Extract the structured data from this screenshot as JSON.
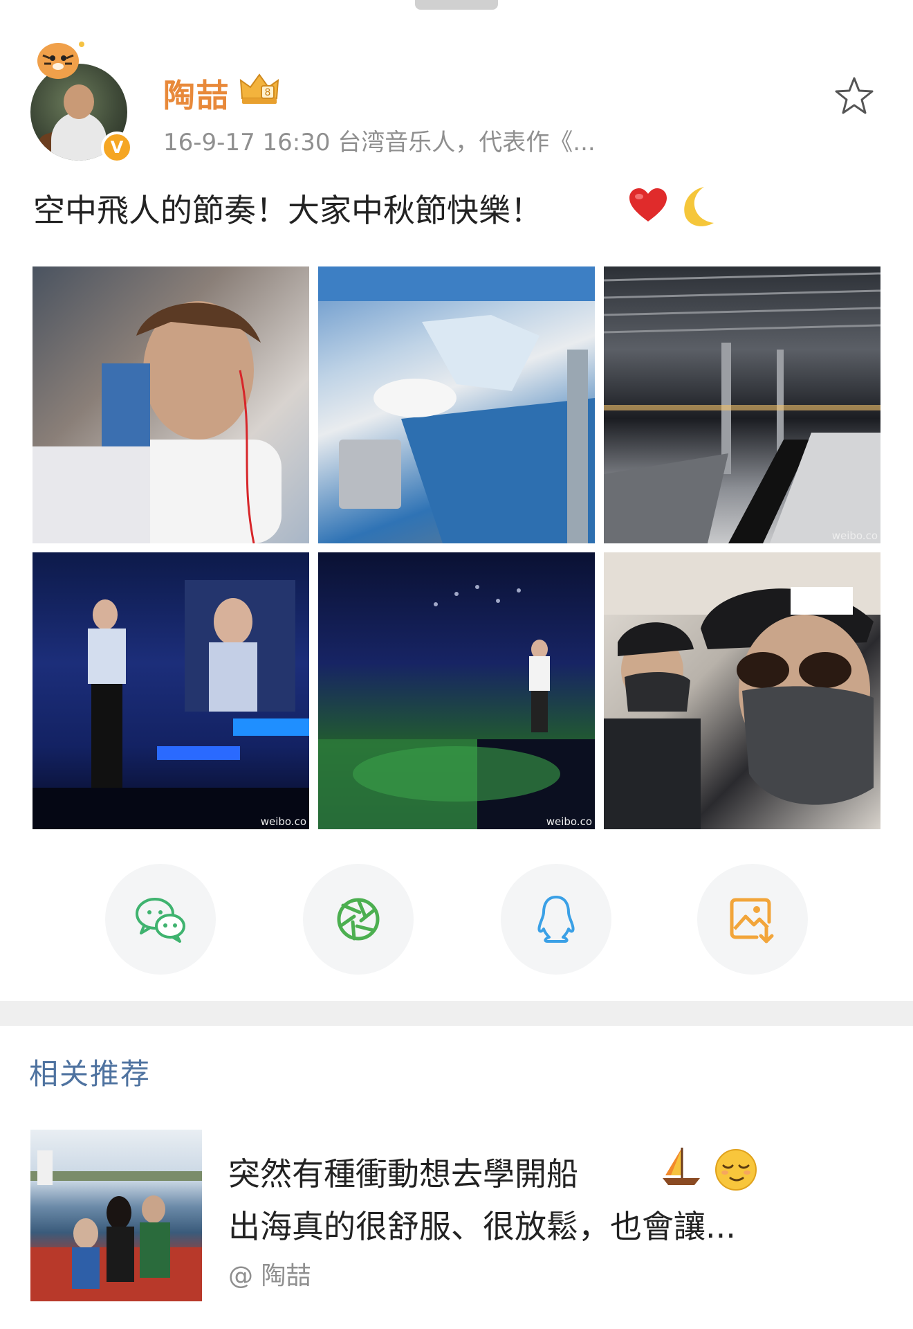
{
  "post": {
    "user_name": "陶喆",
    "meta": "16-9-17 16:30  台湾音乐人，代表作《...",
    "text": "空中飛人的節奏！大家中秋節快樂！",
    "verified_badge": "V",
    "photos": [
      {
        "watermark": ""
      },
      {
        "watermark": ""
      },
      {
        "watermark": "weibo.co"
      },
      {
        "watermark": "weibo.co"
      },
      {
        "watermark": "weibo.co"
      },
      {
        "watermark": ""
      }
    ]
  },
  "share": {
    "items": [
      "wechat-icon",
      "moments-icon",
      "qq-icon",
      "save-image-icon"
    ],
    "colors": {
      "wechat": "#3fb36f",
      "moments": "#4caf50",
      "qq": "#3aa0e6",
      "save": "#f2a53a"
    }
  },
  "related": {
    "title": "相关推荐",
    "item": {
      "line1": "突然有種衝動想去學開船",
      "line2": "出海真的很舒服、很放鬆，也會讓...",
      "author": "@ 陶喆"
    }
  },
  "colors": {
    "accent_name": "#e8893a",
    "section_title": "#4f73a0",
    "meta": "#8f8f8f"
  }
}
